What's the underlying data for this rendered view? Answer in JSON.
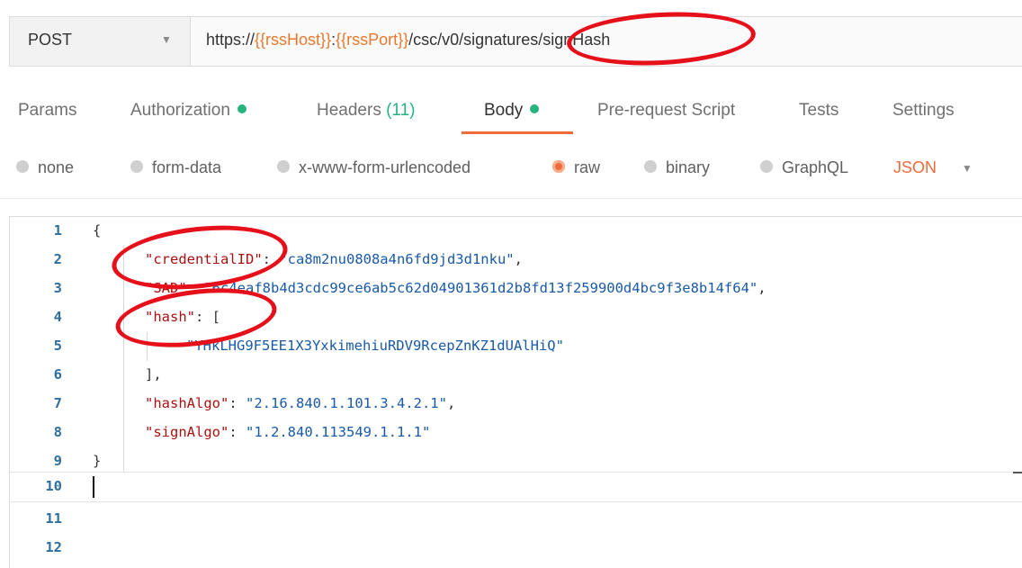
{
  "request": {
    "method": "POST",
    "url_prefix": "https://",
    "url_var1": "{{rssHost}}",
    "url_colon": ":",
    "url_var2": "{{rssPort}}",
    "url_path": "/csc/v0/signatures/signHash"
  },
  "tabs": [
    {
      "label": "Params"
    },
    {
      "label": "Authorization"
    },
    {
      "label": "Headers",
      "count": "(11)"
    },
    {
      "label": "Body"
    },
    {
      "label": "Pre-request Script"
    },
    {
      "label": "Tests"
    },
    {
      "label": "Settings"
    }
  ],
  "body_types": {
    "options": [
      "none",
      "form-data",
      "x-www-form-urlencoded",
      "raw",
      "binary",
      "GraphQL"
    ],
    "selected": "raw",
    "format": "JSON"
  },
  "editor": {
    "line_numbers": [
      "1",
      "2",
      "3",
      "4",
      "5",
      "6",
      "7",
      "8",
      "9",
      "10",
      "11",
      "12"
    ],
    "lines": {
      "l1": "{",
      "l2_key": "\"credentialID\"",
      "l2_sep": ": ",
      "l2_val": "\"ca8m2nu0808a4n6fd9jd3d1nku\"",
      "l2_end": ",",
      "l3_key": "\"SAD\"",
      "l3_sep": ": ",
      "l3_val": "\"6c4eaf8b4d3cdc99ce6ab5c62d04901361d2b8fd13f259900d4bc9f3e8b14f64\"",
      "l3_end": ",",
      "l4_key": "\"hash\"",
      "l4_sep": ": [",
      "l5_val": "\"YHkLHG9F5EE1X3YxkimehiuRDV9RcepZnKZ1dUAlHiQ\"",
      "l6": "],",
      "l7_key": "\"hashAlgo\"",
      "l7_sep": ": ",
      "l7_val": "\"2.16.840.1.101.3.4.2.1\"",
      "l7_end": ",",
      "l8_key": "\"signAlgo\"",
      "l8_sep": ": ",
      "l8_val": "\"1.2.840.113549.1.1.1\"",
      "l9": "}"
    }
  },
  "colors": {
    "accent": "#f26b3a",
    "status_green": "#26b47f",
    "annotation_red": "#e5101a"
  }
}
